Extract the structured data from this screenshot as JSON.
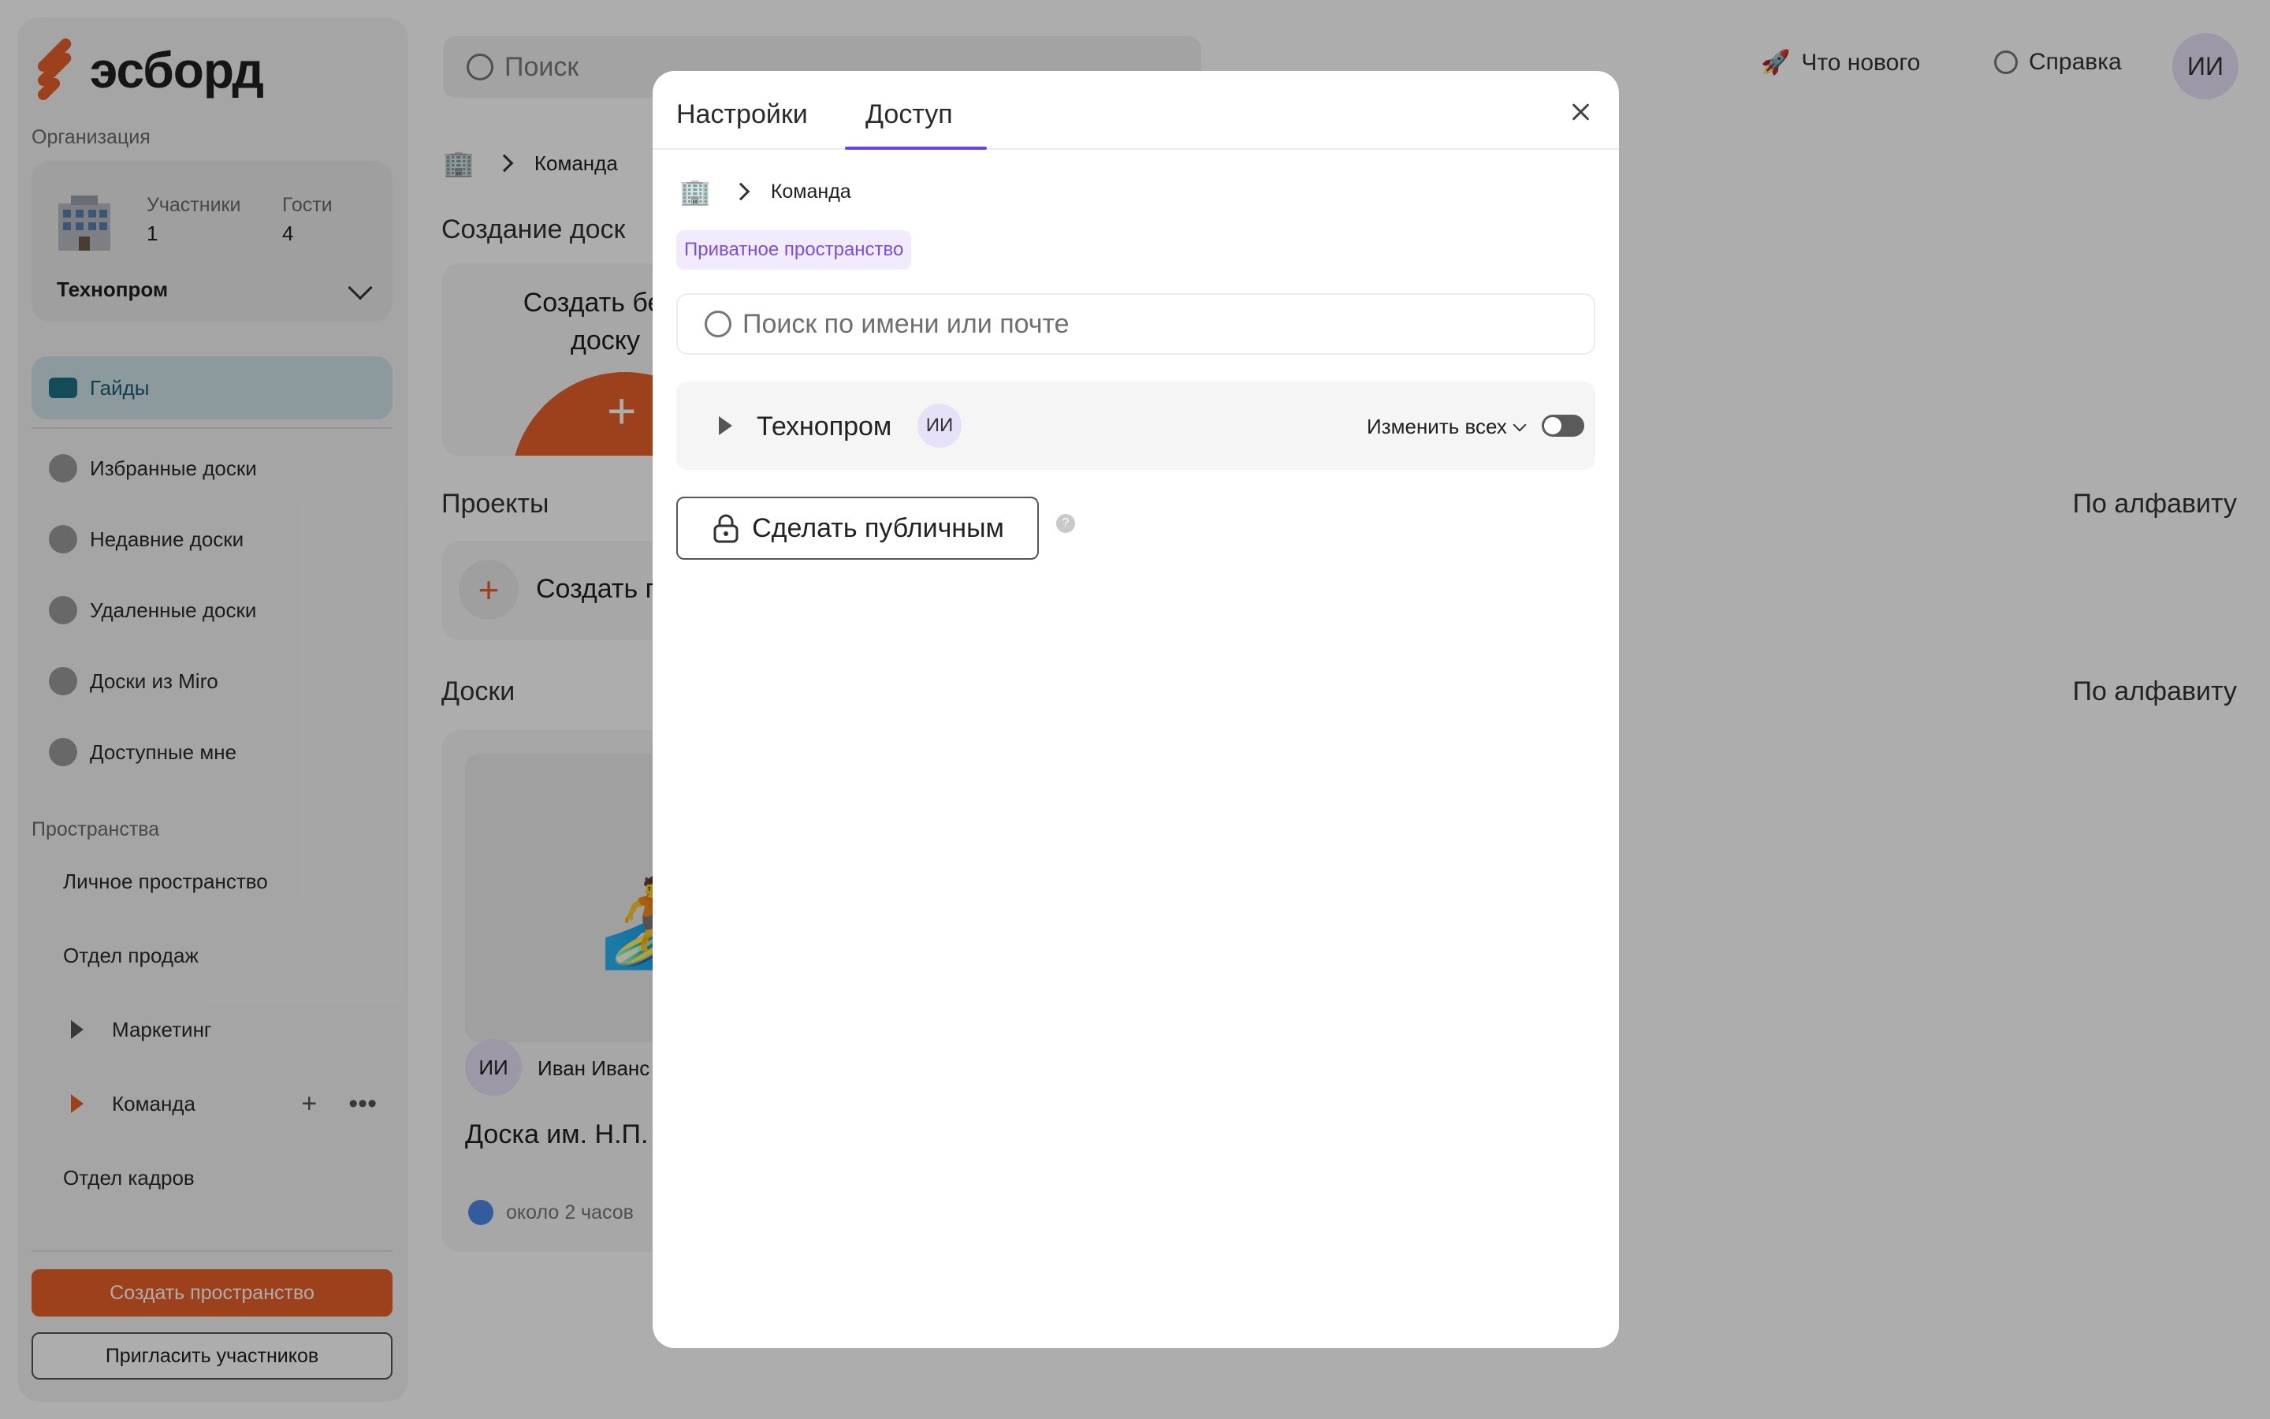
{
  "app": {
    "logo_text": "эсборд",
    "search_placeholder": "Поиск",
    "whats_new": "Что нового",
    "help": "Справка",
    "user_initials": "ИИ"
  },
  "sidebar": {
    "org_label": "Организация",
    "org": {
      "members_label": "Участники",
      "members_value": "1",
      "guests_label": "Гости",
      "guests_value": "4",
      "name": "Технопром"
    },
    "nav": [
      {
        "label": "Гайды"
      },
      {
        "label": "Избранные доски"
      },
      {
        "label": "Недавние доски"
      },
      {
        "label": "Удаленные доски"
      },
      {
        "label": "Доски из Miro"
      },
      {
        "label": "Доступные мне"
      }
    ],
    "spaces_label": "Пространства",
    "spaces": [
      {
        "label": "Личное пространство"
      },
      {
        "label": "Отдел продаж"
      },
      {
        "label": "Маркетинг"
      },
      {
        "label": "Команда"
      },
      {
        "label": "Отдел кадров"
      }
    ],
    "create_space": "Создать пространство",
    "invite": "Пригласить участников"
  },
  "main": {
    "breadcrumb": "Команда",
    "create_section": "Создание доск",
    "create_card_line1": "Создать беск",
    "create_card_line2": "доску",
    "projects": "Проекты",
    "sort": "По алфавиту",
    "create_project": "Создать п",
    "boards": "Доски",
    "board_owner_initials": "ИИ",
    "board_owner": "Иван Иванс",
    "board_title": "Доска им. Н.П.",
    "board_time": "около 2 часов"
  },
  "modal": {
    "tabs": [
      {
        "label": "Настройки"
      },
      {
        "label": "Доступ"
      }
    ],
    "breadcrumb": "Команда",
    "badge": "Приватное пространство",
    "search_placeholder": "Поиск по имени или почте",
    "row": {
      "name": "Технопром",
      "initials": "ИИ",
      "change_all": "Изменить всех"
    },
    "make_public": "Сделать публичным",
    "help_symbol": "?"
  },
  "colors": {
    "accent": "#e8612a",
    "brand_purple": "#6c3df4",
    "active_teal": "#1c6f82"
  }
}
